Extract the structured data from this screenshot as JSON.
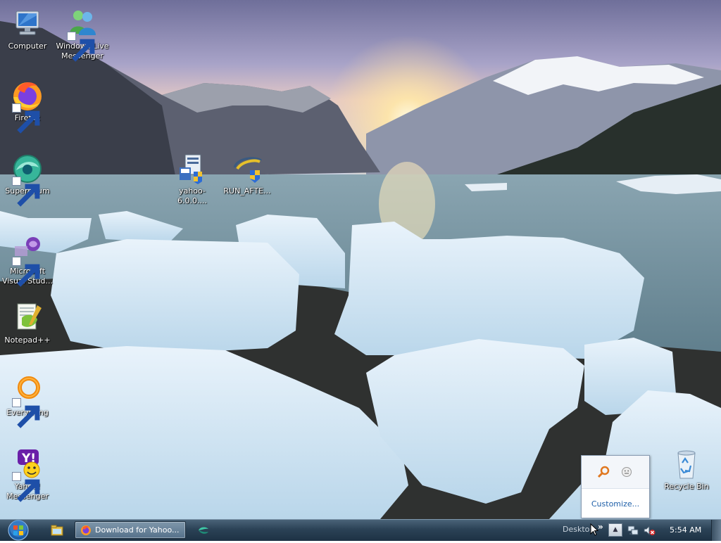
{
  "desktop": {
    "icons": [
      {
        "label_line1": "Computer",
        "label_line2": ""
      },
      {
        "label_line1": "Windows Live",
        "label_line2": "Messenger"
      },
      {
        "label_line1": "Firefox",
        "label_line2": ""
      },
      {
        "label_line1": "Supermium",
        "label_line2": ""
      },
      {
        "label_line1": "yahoo-6.0.0....",
        "label_line2": ""
      },
      {
        "label_line1": "RUN_AFTE...",
        "label_line2": ""
      },
      {
        "label_line1": "Microsoft",
        "label_line2": "Visual Stud..."
      },
      {
        "label_line1": "Notepad++",
        "label_line2": ""
      },
      {
        "label_line1": "Everything",
        "label_line2": ""
      },
      {
        "label_line1": "Yahoo!",
        "label_line2": "Messenger"
      },
      {
        "label_line1": "Recycle Bin",
        "label_line2": ""
      }
    ]
  },
  "tray_popup": {
    "customize_label": "Customize..."
  },
  "taskbar": {
    "active_task_label": "Download for Yahoo...",
    "desktop_toolbar_label": "Desktop",
    "chevron": "»",
    "tray_expand_glyph": "▲",
    "clock": "5:54 AM"
  },
  "colors": {
    "taskbar_top": "#4a6378",
    "taskbar_bottom": "#1d3244",
    "link_blue": "#1e5fa8"
  },
  "icon_names": [
    "start-orb-icon",
    "explorer-icon",
    "firefox-icon",
    "network-icon",
    "volume-muted-icon",
    "search-icon",
    "smiley-icon"
  ]
}
